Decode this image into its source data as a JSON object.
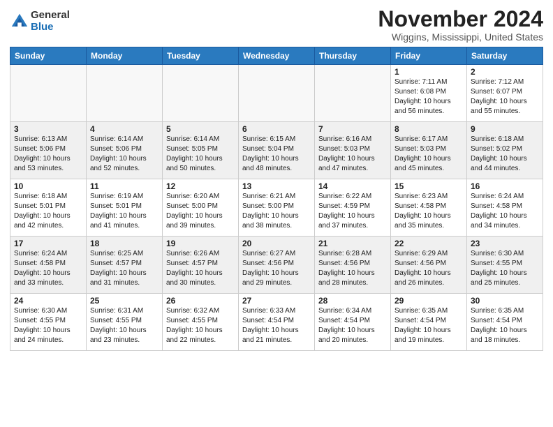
{
  "header": {
    "logo": {
      "general": "General",
      "blue": "Blue"
    },
    "title": "November 2024",
    "location": "Wiggins, Mississippi, United States"
  },
  "days_of_week": [
    "Sunday",
    "Monday",
    "Tuesday",
    "Wednesday",
    "Thursday",
    "Friday",
    "Saturday"
  ],
  "weeks": [
    [
      {
        "day": "",
        "info": ""
      },
      {
        "day": "",
        "info": ""
      },
      {
        "day": "",
        "info": ""
      },
      {
        "day": "",
        "info": ""
      },
      {
        "day": "",
        "info": ""
      },
      {
        "day": "1",
        "info": "Sunrise: 7:11 AM\nSunset: 6:08 PM\nDaylight: 10 hours\nand 56 minutes."
      },
      {
        "day": "2",
        "info": "Sunrise: 7:12 AM\nSunset: 6:07 PM\nDaylight: 10 hours\nand 55 minutes."
      }
    ],
    [
      {
        "day": "3",
        "info": "Sunrise: 6:13 AM\nSunset: 5:06 PM\nDaylight: 10 hours\nand 53 minutes."
      },
      {
        "day": "4",
        "info": "Sunrise: 6:14 AM\nSunset: 5:06 PM\nDaylight: 10 hours\nand 52 minutes."
      },
      {
        "day": "5",
        "info": "Sunrise: 6:14 AM\nSunset: 5:05 PM\nDaylight: 10 hours\nand 50 minutes."
      },
      {
        "day": "6",
        "info": "Sunrise: 6:15 AM\nSunset: 5:04 PM\nDaylight: 10 hours\nand 48 minutes."
      },
      {
        "day": "7",
        "info": "Sunrise: 6:16 AM\nSunset: 5:03 PM\nDaylight: 10 hours\nand 47 minutes."
      },
      {
        "day": "8",
        "info": "Sunrise: 6:17 AM\nSunset: 5:03 PM\nDaylight: 10 hours\nand 45 minutes."
      },
      {
        "day": "9",
        "info": "Sunrise: 6:18 AM\nSunset: 5:02 PM\nDaylight: 10 hours\nand 44 minutes."
      }
    ],
    [
      {
        "day": "10",
        "info": "Sunrise: 6:18 AM\nSunset: 5:01 PM\nDaylight: 10 hours\nand 42 minutes."
      },
      {
        "day": "11",
        "info": "Sunrise: 6:19 AM\nSunset: 5:01 PM\nDaylight: 10 hours\nand 41 minutes."
      },
      {
        "day": "12",
        "info": "Sunrise: 6:20 AM\nSunset: 5:00 PM\nDaylight: 10 hours\nand 39 minutes."
      },
      {
        "day": "13",
        "info": "Sunrise: 6:21 AM\nSunset: 5:00 PM\nDaylight: 10 hours\nand 38 minutes."
      },
      {
        "day": "14",
        "info": "Sunrise: 6:22 AM\nSunset: 4:59 PM\nDaylight: 10 hours\nand 37 minutes."
      },
      {
        "day": "15",
        "info": "Sunrise: 6:23 AM\nSunset: 4:58 PM\nDaylight: 10 hours\nand 35 minutes."
      },
      {
        "day": "16",
        "info": "Sunrise: 6:24 AM\nSunset: 4:58 PM\nDaylight: 10 hours\nand 34 minutes."
      }
    ],
    [
      {
        "day": "17",
        "info": "Sunrise: 6:24 AM\nSunset: 4:58 PM\nDaylight: 10 hours\nand 33 minutes."
      },
      {
        "day": "18",
        "info": "Sunrise: 6:25 AM\nSunset: 4:57 PM\nDaylight: 10 hours\nand 31 minutes."
      },
      {
        "day": "19",
        "info": "Sunrise: 6:26 AM\nSunset: 4:57 PM\nDaylight: 10 hours\nand 30 minutes."
      },
      {
        "day": "20",
        "info": "Sunrise: 6:27 AM\nSunset: 4:56 PM\nDaylight: 10 hours\nand 29 minutes."
      },
      {
        "day": "21",
        "info": "Sunrise: 6:28 AM\nSunset: 4:56 PM\nDaylight: 10 hours\nand 28 minutes."
      },
      {
        "day": "22",
        "info": "Sunrise: 6:29 AM\nSunset: 4:56 PM\nDaylight: 10 hours\nand 26 minutes."
      },
      {
        "day": "23",
        "info": "Sunrise: 6:30 AM\nSunset: 4:55 PM\nDaylight: 10 hours\nand 25 minutes."
      }
    ],
    [
      {
        "day": "24",
        "info": "Sunrise: 6:30 AM\nSunset: 4:55 PM\nDaylight: 10 hours\nand 24 minutes."
      },
      {
        "day": "25",
        "info": "Sunrise: 6:31 AM\nSunset: 4:55 PM\nDaylight: 10 hours\nand 23 minutes."
      },
      {
        "day": "26",
        "info": "Sunrise: 6:32 AM\nSunset: 4:55 PM\nDaylight: 10 hours\nand 22 minutes."
      },
      {
        "day": "27",
        "info": "Sunrise: 6:33 AM\nSunset: 4:54 PM\nDaylight: 10 hours\nand 21 minutes."
      },
      {
        "day": "28",
        "info": "Sunrise: 6:34 AM\nSunset: 4:54 PM\nDaylight: 10 hours\nand 20 minutes."
      },
      {
        "day": "29",
        "info": "Sunrise: 6:35 AM\nSunset: 4:54 PM\nDaylight: 10 hours\nand 19 minutes."
      },
      {
        "day": "30",
        "info": "Sunrise: 6:35 AM\nSunset: 4:54 PM\nDaylight: 10 hours\nand 18 minutes."
      }
    ]
  ]
}
